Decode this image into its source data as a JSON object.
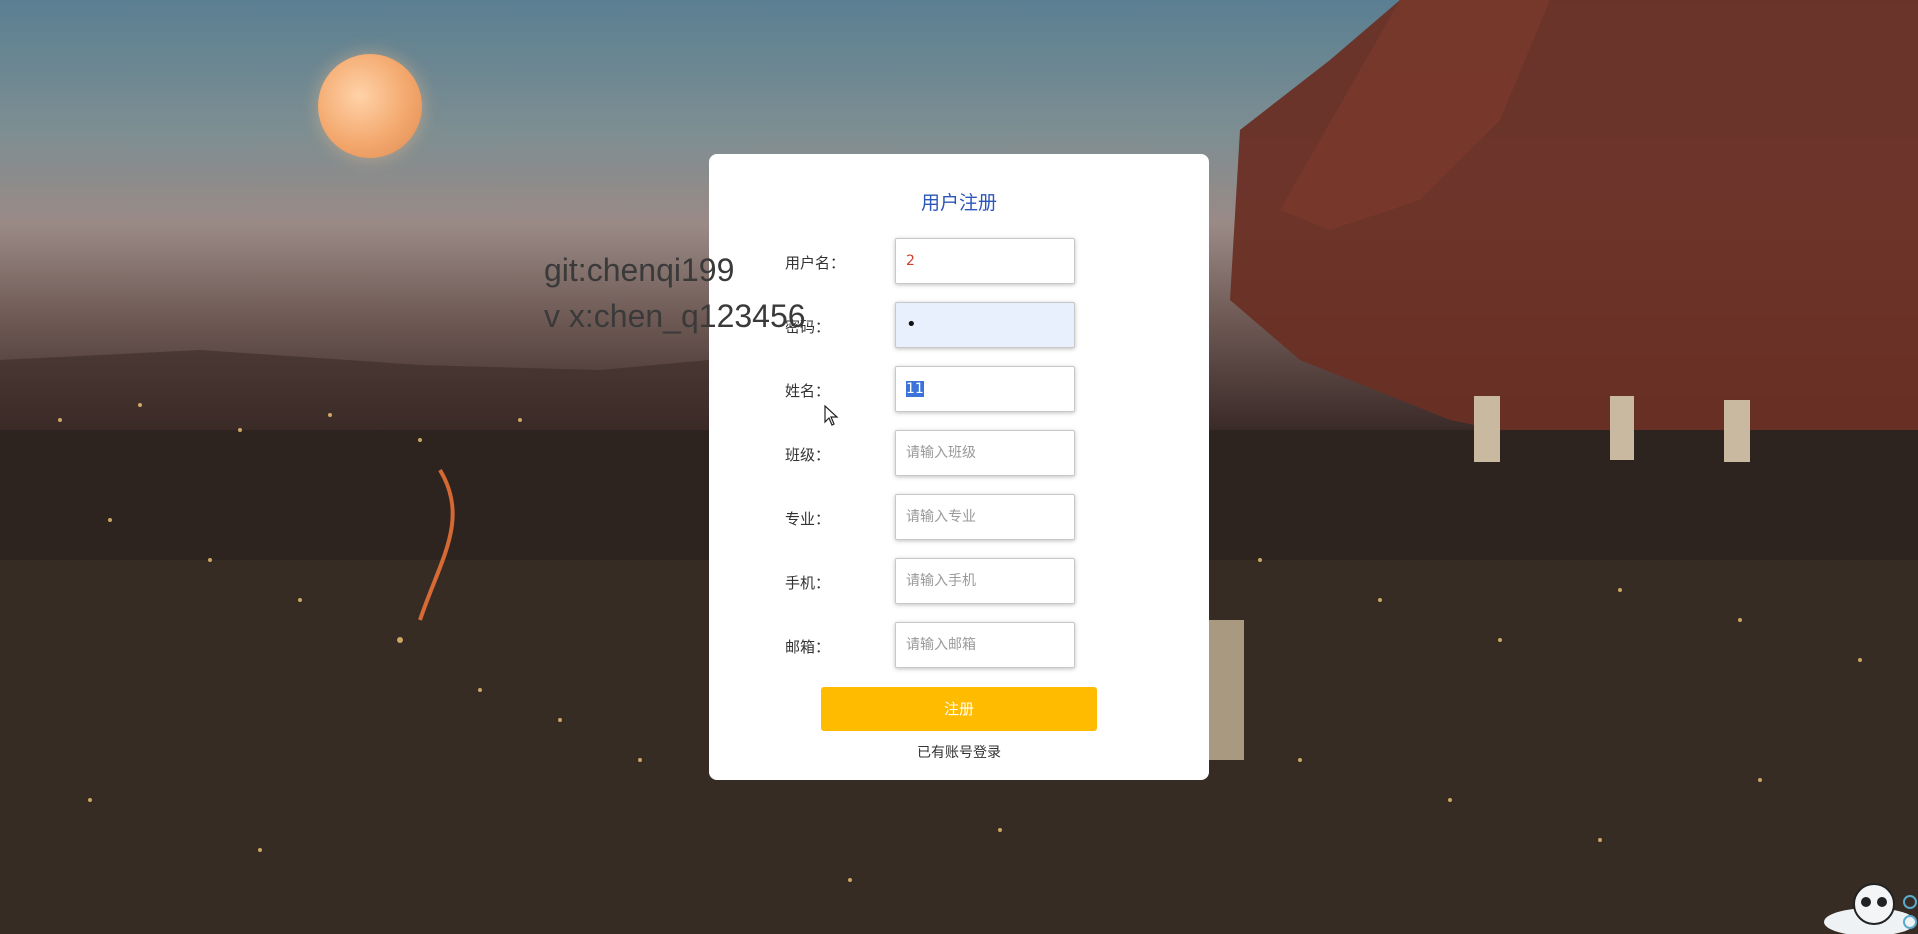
{
  "watermark": {
    "line1": "git:chenqi199",
    "line2": "v x:chen_q123456"
  },
  "form": {
    "title": "用户注册",
    "fields": [
      {
        "label": "用户名：",
        "value": "2",
        "placeholder": ""
      },
      {
        "label": "密码：",
        "value": "•",
        "placeholder": ""
      },
      {
        "label": "姓名：",
        "value": "11",
        "placeholder": ""
      },
      {
        "label": "班级：",
        "value": "",
        "placeholder": "请输入班级"
      },
      {
        "label": "专业：",
        "value": "",
        "placeholder": "请输入专业"
      },
      {
        "label": "手机：",
        "value": "",
        "placeholder": "请输入手机"
      },
      {
        "label": "邮箱：",
        "value": "",
        "placeholder": "请输入邮箱"
      }
    ],
    "submit_label": "注册",
    "login_link": "已有账号登录"
  },
  "colors": {
    "title": "#2c56b8",
    "submit_bg": "#ffbb00",
    "username_value": "#d0402a",
    "autofill_bg": "#e8f0fe",
    "selection": "#3b73d9"
  },
  "icons": [
    "moon-image",
    "mouse-cursor-icon",
    "mascot-icon"
  ]
}
